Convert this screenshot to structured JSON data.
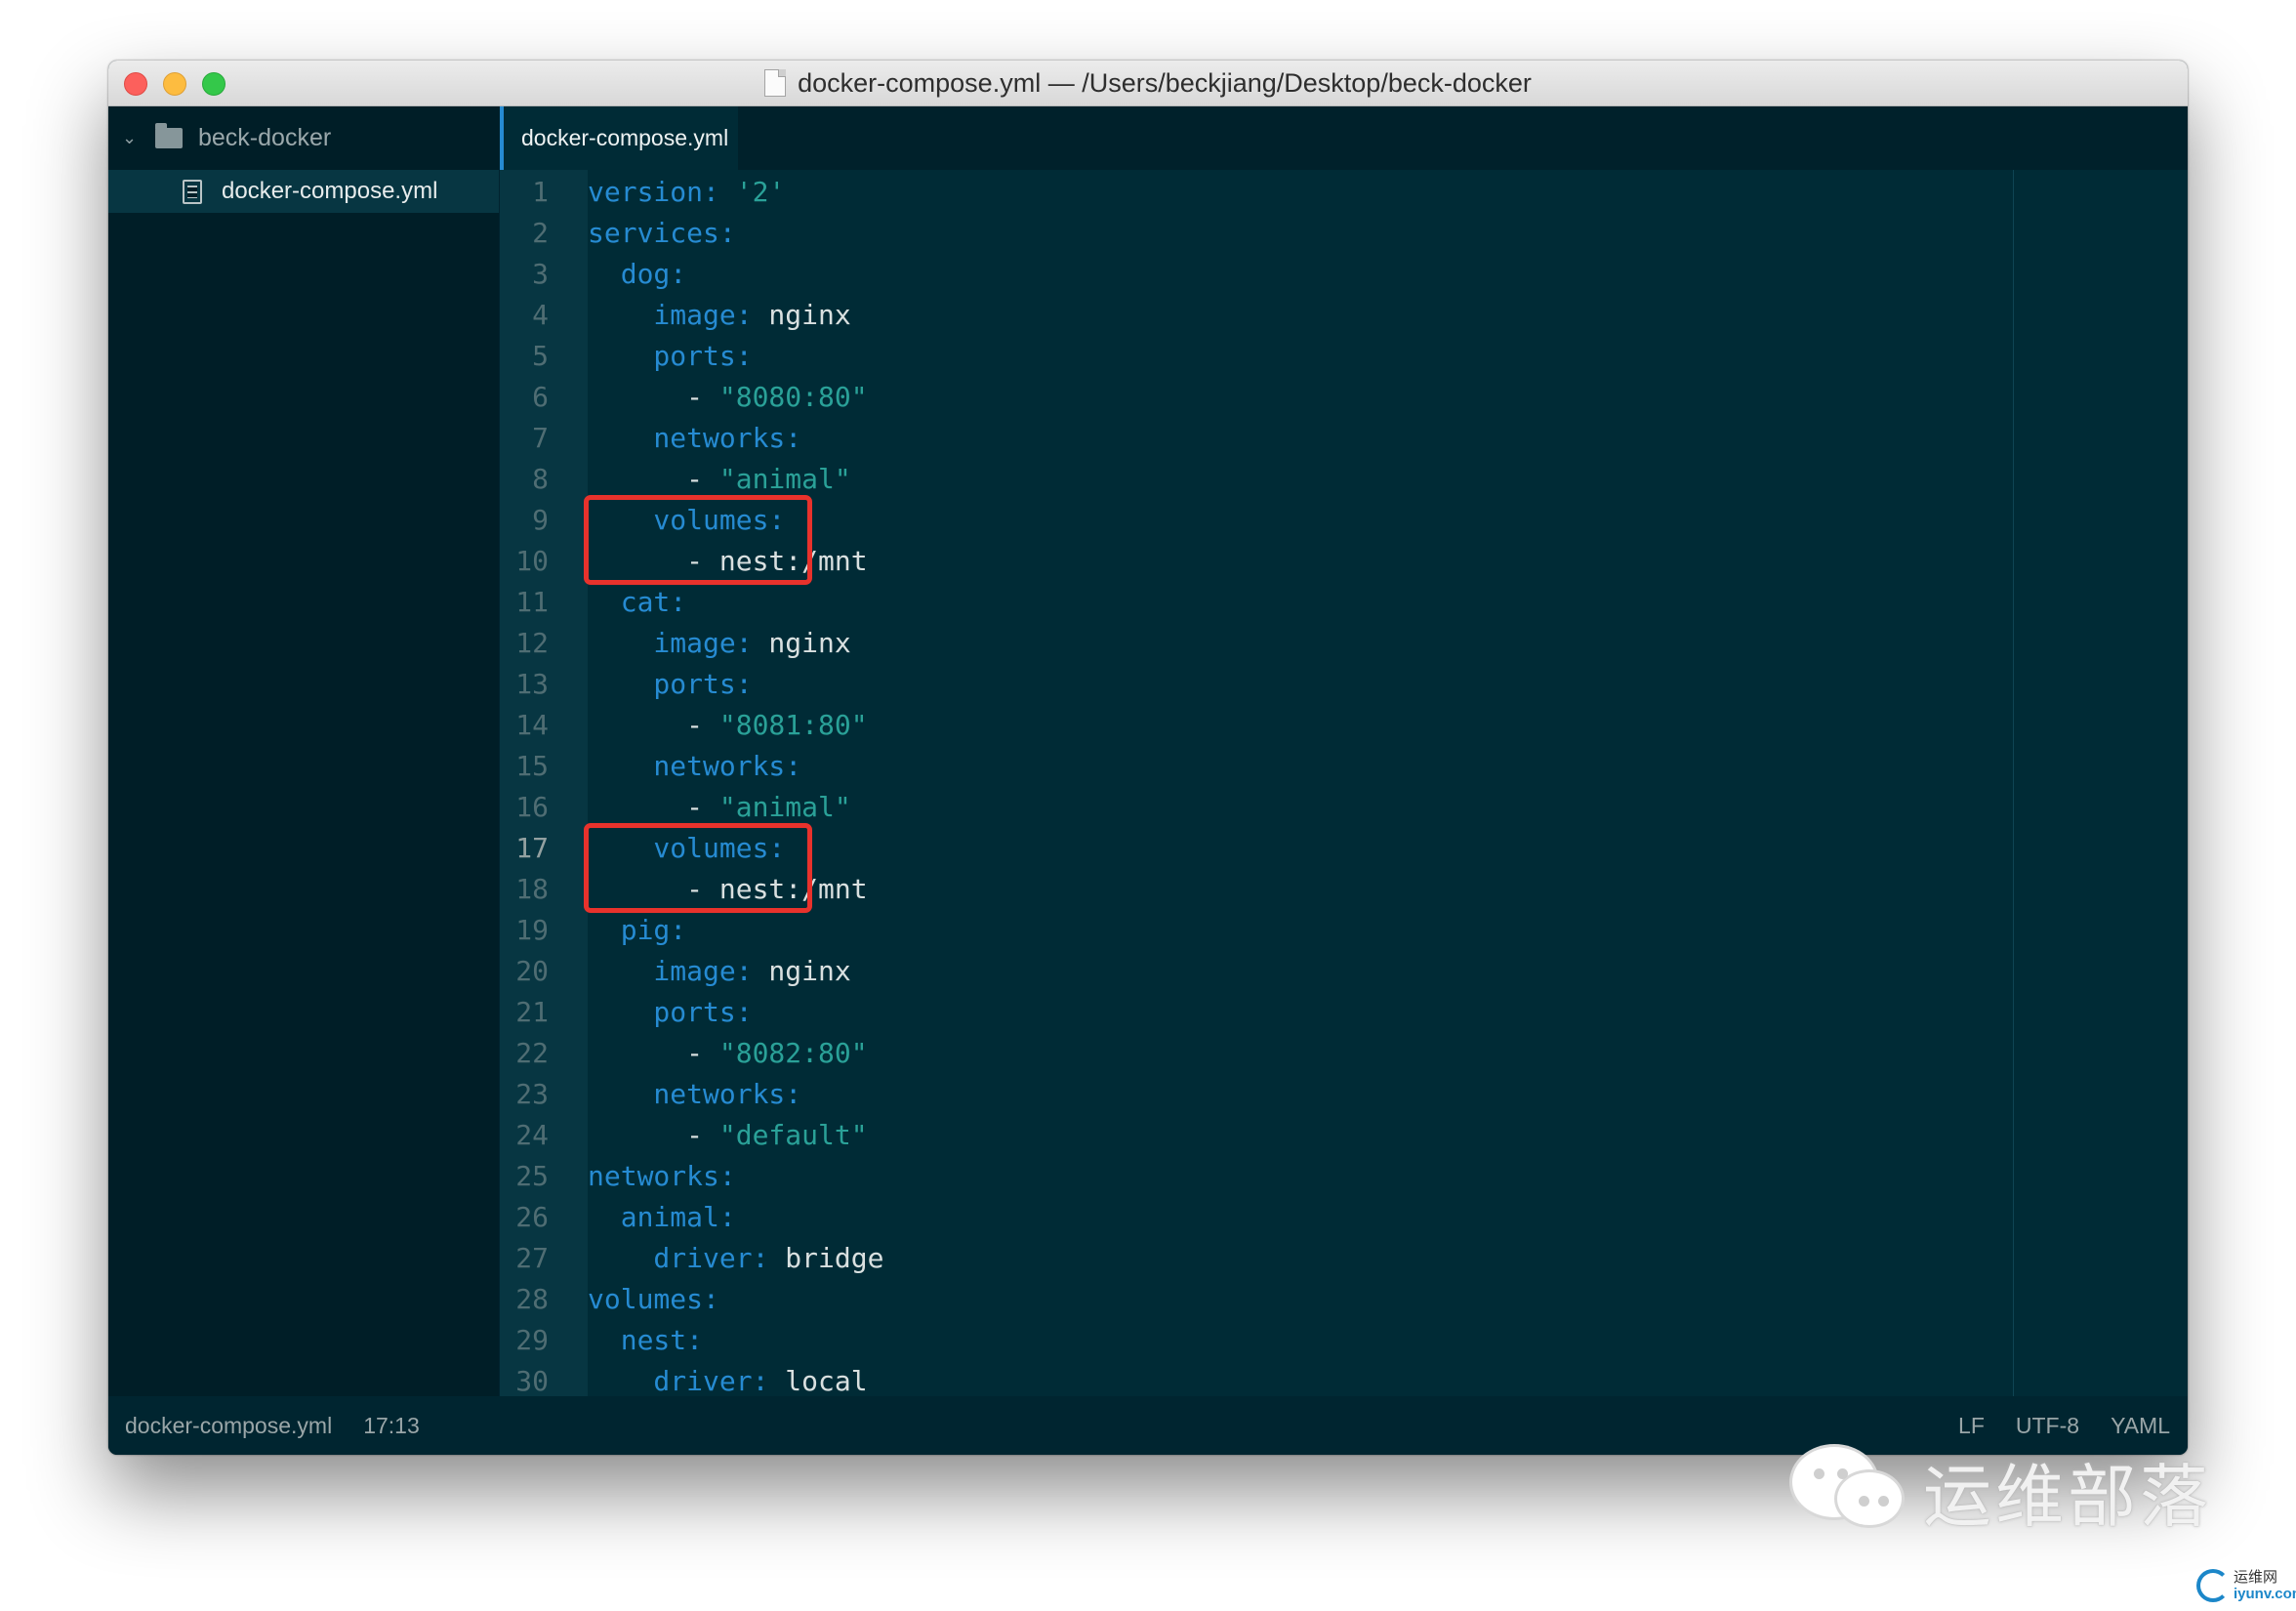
{
  "window": {
    "title": "docker-compose.yml — /Users/beckjiang/Desktop/beck-docker"
  },
  "sidebar": {
    "root_folder": "beck-docker",
    "files": [
      "docker-compose.yml"
    ]
  },
  "tabs": [
    {
      "label": "docker-compose.yml",
      "active": true
    }
  ],
  "editor": {
    "current_line": 17,
    "highlighted_ranges": [
      [
        9,
        10
      ],
      [
        17,
        18
      ]
    ],
    "highlight_color": "#e8322c",
    "lines": [
      {
        "n": "1",
        "segs": [
          {
            "t": "version:",
            "c": "key"
          },
          {
            "t": " ",
            "c": "plain"
          },
          {
            "t": "'2'",
            "c": "str"
          }
        ]
      },
      {
        "n": "2",
        "segs": [
          {
            "t": "services:",
            "c": "key"
          }
        ]
      },
      {
        "n": "3",
        "segs": [
          {
            "t": "  dog:",
            "c": "key"
          }
        ]
      },
      {
        "n": "4",
        "segs": [
          {
            "t": "    image:",
            "c": "key"
          },
          {
            "t": " nginx",
            "c": "plain"
          }
        ]
      },
      {
        "n": "5",
        "segs": [
          {
            "t": "    ports:",
            "c": "key"
          }
        ]
      },
      {
        "n": "6",
        "segs": [
          {
            "t": "      - ",
            "c": "plain"
          },
          {
            "t": "\"8080:80\"",
            "c": "str"
          }
        ]
      },
      {
        "n": "7",
        "segs": [
          {
            "t": "    networks:",
            "c": "key"
          }
        ]
      },
      {
        "n": "8",
        "segs": [
          {
            "t": "      - ",
            "c": "plain"
          },
          {
            "t": "\"animal\"",
            "c": "str"
          }
        ]
      },
      {
        "n": "9",
        "segs": [
          {
            "t": "    volumes:",
            "c": "key"
          }
        ]
      },
      {
        "n": "10",
        "segs": [
          {
            "t": "      - nest:/mnt",
            "c": "plain"
          }
        ]
      },
      {
        "n": "11",
        "segs": [
          {
            "t": "  cat:",
            "c": "key"
          }
        ]
      },
      {
        "n": "12",
        "segs": [
          {
            "t": "    image:",
            "c": "key"
          },
          {
            "t": " nginx",
            "c": "plain"
          }
        ]
      },
      {
        "n": "13",
        "segs": [
          {
            "t": "    ports:",
            "c": "key"
          }
        ]
      },
      {
        "n": "14",
        "segs": [
          {
            "t": "      - ",
            "c": "plain"
          },
          {
            "t": "\"8081:80\"",
            "c": "str"
          }
        ]
      },
      {
        "n": "15",
        "segs": [
          {
            "t": "    networks:",
            "c": "key"
          }
        ]
      },
      {
        "n": "16",
        "segs": [
          {
            "t": "      - ",
            "c": "plain"
          },
          {
            "t": "\"animal\"",
            "c": "str"
          }
        ]
      },
      {
        "n": "17",
        "segs": [
          {
            "t": "    volumes:",
            "c": "key"
          }
        ]
      },
      {
        "n": "18",
        "segs": [
          {
            "t": "      - nest:/mnt",
            "c": "plain"
          }
        ]
      },
      {
        "n": "19",
        "segs": [
          {
            "t": "  pig:",
            "c": "key"
          }
        ]
      },
      {
        "n": "20",
        "segs": [
          {
            "t": "    image:",
            "c": "key"
          },
          {
            "t": " nginx",
            "c": "plain"
          }
        ]
      },
      {
        "n": "21",
        "segs": [
          {
            "t": "    ports:",
            "c": "key"
          }
        ]
      },
      {
        "n": "22",
        "segs": [
          {
            "t": "      - ",
            "c": "plain"
          },
          {
            "t": "\"8082:80\"",
            "c": "str"
          }
        ]
      },
      {
        "n": "23",
        "segs": [
          {
            "t": "    networks:",
            "c": "key"
          }
        ]
      },
      {
        "n": "24",
        "segs": [
          {
            "t": "      - ",
            "c": "plain"
          },
          {
            "t": "\"default\"",
            "c": "str"
          }
        ]
      },
      {
        "n": "25",
        "segs": [
          {
            "t": "networks:",
            "c": "key"
          }
        ]
      },
      {
        "n": "26",
        "segs": [
          {
            "t": "  animal:",
            "c": "key"
          }
        ]
      },
      {
        "n": "27",
        "segs": [
          {
            "t": "    driver:",
            "c": "key"
          },
          {
            "t": " bridge",
            "c": "plain"
          }
        ]
      },
      {
        "n": "28",
        "segs": [
          {
            "t": "volumes:",
            "c": "key"
          }
        ]
      },
      {
        "n": "29",
        "segs": [
          {
            "t": "  nest:",
            "c": "key"
          }
        ]
      },
      {
        "n": "30",
        "segs": [
          {
            "t": "    driver:",
            "c": "key"
          },
          {
            "t": " local",
            "c": "plain"
          }
        ]
      }
    ]
  },
  "status": {
    "file": "docker-compose.yml",
    "cursor": "17:13",
    "line_ending": "LF",
    "encoding": "UTF-8",
    "grammar": "YAML"
  },
  "watermark": {
    "text": "运维部落",
    "logo_top": "运维网",
    "logo_bottom": "iyunv.com",
    "icon": "wechat-icon"
  }
}
